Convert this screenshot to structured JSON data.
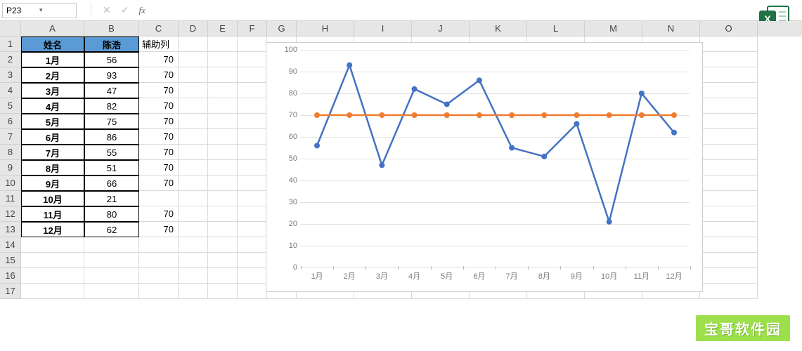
{
  "formula_bar": {
    "cell_ref": "P23",
    "formula": ""
  },
  "columns": [
    "A",
    "B",
    "C",
    "D",
    "E",
    "F",
    "G",
    "H",
    "I",
    "J",
    "K",
    "L",
    "M",
    "N",
    "O"
  ],
  "rows": [
    1,
    2,
    3,
    4,
    5,
    6,
    7,
    8,
    9,
    10,
    11,
    12,
    13,
    14,
    15,
    16,
    17
  ],
  "table": {
    "header_a": "姓名",
    "header_b": "陈浩",
    "header_c": "辅助列",
    "months": [
      "1月",
      "2月",
      "3月",
      "4月",
      "5月",
      "6月",
      "7月",
      "8月",
      "9月",
      "10月",
      "11月",
      "12月"
    ],
    "values": [
      56,
      93,
      47,
      82,
      75,
      86,
      55,
      51,
      66,
      21,
      80,
      62
    ],
    "aux": [
      "70",
      "70",
      "70",
      "70",
      "70",
      "70",
      "70",
      "70",
      "70",
      "",
      "70",
      "70"
    ]
  },
  "chart_data": {
    "type": "line",
    "categories": [
      "1月",
      "2月",
      "3月",
      "4月",
      "5月",
      "6月",
      "7月",
      "8月",
      "9月",
      "10月",
      "11月",
      "12月"
    ],
    "series": [
      {
        "name": "陈浩",
        "values": [
          56,
          93,
          47,
          82,
          75,
          86,
          55,
          51,
          66,
          21,
          80,
          62
        ],
        "color": "#4472c4"
      },
      {
        "name": "辅助列",
        "values": [
          70,
          70,
          70,
          70,
          70,
          70,
          70,
          70,
          70,
          70,
          70,
          70
        ],
        "color": "#ed7d31"
      }
    ],
    "ylim": [
      0,
      100
    ],
    "ystep": 10,
    "title": "",
    "xlabel": "",
    "ylabel": ""
  },
  "watermark": "宝哥软件园"
}
